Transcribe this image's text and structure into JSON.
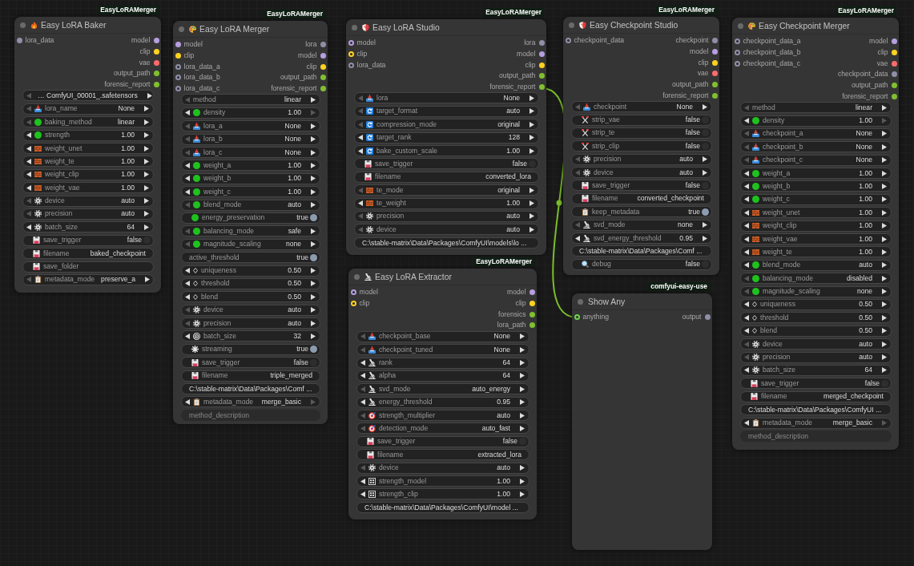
{
  "canvas": {
    "nodes": [
      {
        "badge": "EasyLoRAMerger",
        "title": "Easy LoRA Baker",
        "inputs": [
          {
            "name": "lora_data",
            "color": "#8f8fa8",
            "ring": false
          }
        ],
        "outputs": [
          {
            "name": "model",
            "color": "#b59fe0"
          },
          {
            "name": "clip",
            "color": "#ffd21f"
          },
          {
            "name": "vae",
            "color": "#ff6b6b"
          },
          {
            "name": "output_path",
            "color": "#80c02f"
          },
          {
            "name": "forensic_report",
            "color": "#80c02f"
          }
        ],
        "widgets": [
          {
            "kind": "stepper",
            "value": "… ComfyUI_00001_.safetensors",
            "prev_disabled": true,
            "next_disabled": false
          },
          {
            "kind": "stepper",
            "label": "lora_name",
            "value": "None",
            "prev_disabled": true,
            "next_disabled": false
          },
          {
            "kind": "stepper",
            "label": "baking_method",
            "value": "linear",
            "prev_disabled": true,
            "next_disabled": false
          },
          {
            "kind": "stepper",
            "label": "strength",
            "value": "1.00",
            "prev_disabled": false,
            "next_disabled": false
          },
          {
            "kind": "stepper",
            "label": "weight_unet",
            "value": "1.00",
            "prev_disabled": false,
            "next_disabled": false
          },
          {
            "kind": "stepper",
            "label": "weight_te",
            "value": "1.00",
            "prev_disabled": false,
            "next_disabled": false
          },
          {
            "kind": "stepper",
            "label": "weight_clip",
            "value": "1.00",
            "prev_disabled": false,
            "next_disabled": false
          },
          {
            "kind": "stepper",
            "label": "weight_vae",
            "value": "1.00",
            "prev_disabled": false,
            "next_disabled": false
          },
          {
            "kind": "stepper",
            "label": "device",
            "value": "auto",
            "prev_disabled": true,
            "next_disabled": false
          },
          {
            "kind": "stepper",
            "label": "precision",
            "value": "auto",
            "prev_disabled": true,
            "next_disabled": false
          },
          {
            "kind": "stepper",
            "label": "batch_size",
            "value": "64",
            "prev_disabled": false,
            "next_disabled": false
          },
          {
            "kind": "toggle",
            "label": "save_trigger",
            "value": "false",
            "on": false
          },
          {
            "kind": "text",
            "label": "filename",
            "value": "baked_checkpoint"
          },
          {
            "kind": "text",
            "label": "save_folder"
          },
          {
            "kind": "stepper",
            "label": "metadata_mode",
            "value": "preserve_a",
            "prev_disabled": true,
            "next_disabled": false
          }
        ]
      },
      {
        "badge": "EasyLoRAMerger",
        "title": "Easy LoRA Merger",
        "inputs": [
          {
            "name": "model",
            "color": "#b59fe0",
            "ring": false
          },
          {
            "name": "clip",
            "color": "#ffd21f",
            "ring": false
          },
          {
            "name": "lora_data_a",
            "color": "#8f8fa8",
            "ring": true
          },
          {
            "name": "lora_data_b",
            "color": "#8f8fa8",
            "ring": true
          },
          {
            "name": "lora_data_c",
            "color": "#8f8fa8",
            "ring": true
          }
        ],
        "outputs": [
          {
            "name": "lora",
            "color": "#8f8fa8"
          },
          {
            "name": "model",
            "color": "#b59fe0"
          },
          {
            "name": "clip",
            "color": "#ffd21f"
          },
          {
            "name": "output_path",
            "color": "#80c02f"
          },
          {
            "name": "forensic_report",
            "color": "#80c02f"
          }
        ],
        "widgets": [
          {
            "kind": "stepper",
            "label": "method",
            "value": "linear",
            "prev_disabled": true,
            "next_disabled": false
          },
          {
            "kind": "stepper",
            "label": "density",
            "value": "1.00",
            "prev_disabled": false,
            "next_disabled": true
          },
          {
            "kind": "stepper",
            "label": "lora_a",
            "value": "None",
            "prev_disabled": true,
            "next_disabled": false
          },
          {
            "kind": "stepper",
            "label": "lora_b",
            "value": "None",
            "prev_disabled": true,
            "next_disabled": false
          },
          {
            "kind": "stepper",
            "label": "lora_c",
            "value": "None",
            "prev_disabled": true,
            "next_disabled": false
          },
          {
            "kind": "stepper",
            "label": "weight_a",
            "value": "1.00",
            "prev_disabled": false,
            "next_disabled": false
          },
          {
            "kind": "stepper",
            "label": "weight_b",
            "value": "1.00",
            "prev_disabled": false,
            "next_disabled": false
          },
          {
            "kind": "stepper",
            "label": "weight_c",
            "value": "1.00",
            "prev_disabled": false,
            "next_disabled": false
          },
          {
            "kind": "stepper",
            "label": "blend_mode",
            "value": "auto",
            "prev_disabled": true,
            "next_disabled": false
          },
          {
            "kind": "toggle",
            "label": "energy_preservation",
            "value": "true",
            "on": true
          },
          {
            "kind": "stepper",
            "label": "balancing_mode",
            "value": "safe",
            "prev_disabled": true,
            "next_disabled": false
          },
          {
            "kind": "stepper",
            "label": "magnitude_scaling",
            "value": "none",
            "prev_disabled": true,
            "next_disabled": false
          },
          {
            "kind": "toggle",
            "label": "active_threshold",
            "value": "true",
            "on": true
          },
          {
            "kind": "stepper",
            "label": "uniqueness",
            "value": "0.50",
            "prev_disabled": false,
            "next_disabled": false
          },
          {
            "kind": "stepper",
            "label": "threshold",
            "value": "0.50",
            "prev_disabled": false,
            "next_disabled": false
          },
          {
            "kind": "stepper",
            "label": "blend",
            "value": "0.50",
            "prev_disabled": false,
            "next_disabled": false
          },
          {
            "kind": "stepper",
            "label": "device",
            "value": "auto",
            "prev_disabled": true,
            "next_disabled": false
          },
          {
            "kind": "stepper",
            "label": "precision",
            "value": "auto",
            "prev_disabled": true,
            "next_disabled": false
          },
          {
            "kind": "stepper",
            "label": "batch_size",
            "value": "32",
            "prev_disabled": false,
            "next_disabled": false
          },
          {
            "kind": "toggle",
            "label": "streaming",
            "value": "true",
            "on": true
          },
          {
            "kind": "toggle",
            "label": "save_trigger",
            "value": "false",
            "on": false
          },
          {
            "kind": "text",
            "label": "filename",
            "value": "triple_merged"
          },
          {
            "kind": "text",
            "value": "C:\\stable-matrix\\Data\\Packages\\Comf ..."
          },
          {
            "kind": "stepper",
            "label": "metadata_mode",
            "value": "merge_basic",
            "prev_disabled": false,
            "next_disabled": true
          },
          {
            "kind": "textarea",
            "placeholder": "method_description"
          }
        ]
      },
      {
        "badge": "EasyLoRAMerger",
        "title": "Easy LoRA Studio",
        "inputs": [
          {
            "name": "model",
            "color": "#b59fe0",
            "ring": true
          },
          {
            "name": "clip",
            "color": "#ffd21f",
            "ring": true
          },
          {
            "name": "lora_data",
            "color": "#8f8fa8",
            "ring": true
          }
        ],
        "outputs": [
          {
            "name": "lora",
            "color": "#8f8fa8"
          },
          {
            "name": "model",
            "color": "#b59fe0"
          },
          {
            "name": "clip",
            "color": "#ffd21f"
          },
          {
            "name": "output_path",
            "color": "#80c02f"
          },
          {
            "name": "forensic_report",
            "color": "#80c02f"
          }
        ],
        "widgets": [
          {
            "kind": "stepper",
            "label": "lora",
            "value": "None",
            "prev_disabled": true,
            "next_disabled": false
          },
          {
            "kind": "stepper",
            "label": "target_format",
            "value": "auto",
            "prev_disabled": true,
            "next_disabled": false
          },
          {
            "kind": "stepper",
            "label": "compression_mode",
            "value": "original",
            "prev_disabled": true,
            "next_disabled": false
          },
          {
            "kind": "stepper",
            "label": "target_rank",
            "value": "128",
            "prev_disabled": false,
            "next_disabled": false
          },
          {
            "kind": "stepper",
            "label": "bake_custom_scale",
            "value": "1.00",
            "prev_disabled": false,
            "next_disabled": false
          },
          {
            "kind": "toggle",
            "label": "save_trigger",
            "value": "false",
            "on": false
          },
          {
            "kind": "text",
            "label": "filename",
            "value": "converted_lora"
          },
          {
            "kind": "stepper",
            "label": "te_mode",
            "value": "original",
            "prev_disabled": true,
            "next_disabled": false
          },
          {
            "kind": "stepper",
            "label": "te_weight",
            "value": "1.00",
            "prev_disabled": false,
            "next_disabled": false
          },
          {
            "kind": "stepper",
            "label": "precision",
            "value": "auto",
            "prev_disabled": true,
            "next_disabled": false
          },
          {
            "kind": "stepper",
            "label": "device",
            "value": "auto",
            "prev_disabled": true,
            "next_disabled": false
          },
          {
            "kind": "text",
            "value": "C:\\stable-matrix\\Data\\Packages\\ComfyUI\\models\\lo ..."
          }
        ]
      },
      {
        "badge": "EasyLoRAMerger",
        "title": "Easy LoRA Extractor",
        "inputs": [
          {
            "name": "model",
            "color": "#b59fe0",
            "ring": true
          },
          {
            "name": "clip",
            "color": "#ffd21f",
            "ring": true
          }
        ],
        "outputs": [
          {
            "name": "model",
            "color": "#b59fe0"
          },
          {
            "name": "clip",
            "color": "#ffd21f"
          },
          {
            "name": "forensics",
            "color": "#80c02f"
          },
          {
            "name": "lora_path",
            "color": "#80c02f"
          }
        ],
        "widgets": [
          {
            "kind": "stepper",
            "label": "checkpoint_base",
            "value": "None",
            "prev_disabled": true,
            "next_disabled": false
          },
          {
            "kind": "stepper",
            "label": "checkpoint_tuned",
            "value": "None",
            "prev_disabled": true,
            "next_disabled": false
          },
          {
            "kind": "stepper",
            "label": "rank",
            "value": "64",
            "prev_disabled": false,
            "next_disabled": false
          },
          {
            "kind": "stepper",
            "label": "alpha",
            "value": "64",
            "prev_disabled": false,
            "next_disabled": false
          },
          {
            "kind": "stepper",
            "label": "svd_mode",
            "value": "auto_energy",
            "prev_disabled": true,
            "next_disabled": false
          },
          {
            "kind": "stepper",
            "label": "energy_threshold",
            "value": "0.95",
            "prev_disabled": false,
            "next_disabled": false
          },
          {
            "kind": "stepper",
            "label": "strength_multiplier",
            "value": "auto",
            "prev_disabled": true,
            "next_disabled": false
          },
          {
            "kind": "stepper",
            "label": "detection_mode",
            "value": "auto_fast",
            "prev_disabled": true,
            "next_disabled": false
          },
          {
            "kind": "toggle",
            "label": "save_trigger",
            "value": "false",
            "on": false
          },
          {
            "kind": "text",
            "label": "filename",
            "value": "extracted_lora"
          },
          {
            "kind": "stepper",
            "label": "device",
            "value": "auto",
            "prev_disabled": true,
            "next_disabled": false
          },
          {
            "kind": "stepper",
            "label": "strength_model",
            "value": "1.00",
            "prev_disabled": false,
            "next_disabled": false
          },
          {
            "kind": "stepper",
            "label": "strength_clip",
            "value": "1.00",
            "prev_disabled": false,
            "next_disabled": false
          },
          {
            "kind": "text",
            "value": "C:\\stable-matrix\\Data\\Packages\\ComfyUI\\model ..."
          }
        ]
      },
      {
        "badge": "EasyLoRAMerger",
        "title": "Easy Checkpoint Studio",
        "inputs": [
          {
            "name": "checkpoint_data",
            "color": "#8f8fa8",
            "ring": true
          }
        ],
        "outputs": [
          {
            "name": "checkpoint",
            "color": "#8f8fa8"
          },
          {
            "name": "model",
            "color": "#b59fe0"
          },
          {
            "name": "clip",
            "color": "#ffd21f"
          },
          {
            "name": "vae",
            "color": "#ff6b6b"
          },
          {
            "name": "output_path",
            "color": "#80c02f"
          },
          {
            "name": "forensic_report",
            "color": "#80c02f"
          }
        ],
        "widgets": [
          {
            "kind": "stepper",
            "label": "checkpoint",
            "value": "None",
            "prev_disabled": true,
            "next_disabled": false
          },
          {
            "kind": "toggle",
            "label": "strip_vae",
            "value": "false",
            "on": false
          },
          {
            "kind": "toggle",
            "label": "strip_te",
            "value": "false",
            "on": false
          },
          {
            "kind": "toggle",
            "label": "strip_clip",
            "value": "false",
            "on": false
          },
          {
            "kind": "stepper",
            "label": "precision",
            "value": "auto",
            "prev_disabled": true,
            "next_disabled": false
          },
          {
            "kind": "stepper",
            "label": "device",
            "value": "auto",
            "prev_disabled": true,
            "next_disabled": false
          },
          {
            "kind": "toggle",
            "label": "save_trigger",
            "value": "false",
            "on": false
          },
          {
            "kind": "text",
            "label": "filename",
            "value": "converted_checkpoint"
          },
          {
            "kind": "toggle",
            "label": "keep_metadata",
            "value": "true",
            "on": true
          },
          {
            "kind": "stepper",
            "label": "svd_mode",
            "value": "none",
            "prev_disabled": true,
            "next_disabled": false
          },
          {
            "kind": "stepper",
            "label": "svd_energy_threshold",
            "value": "0.95",
            "prev_disabled": false,
            "next_disabled": false
          },
          {
            "kind": "text",
            "value": "C:\\stable-matrix\\Data\\Packages\\Comf ..."
          },
          {
            "kind": "toggle",
            "label": "debug",
            "value": "false",
            "on": false
          }
        ]
      },
      {
        "badge": "comfyui-easy-use",
        "title": "Show Any",
        "inputs": [
          {
            "name": "anything",
            "color": "#6fd14f",
            "ring": true
          }
        ],
        "outputs": [
          {
            "name": "output",
            "color": "#8f8fa8"
          }
        ]
      },
      {
        "badge": "EasyLoRAMerger",
        "title": "Easy Checkpoint Merger",
        "inputs": [
          {
            "name": "checkpoint_data_a",
            "color": "#8f8fa8",
            "ring": true
          },
          {
            "name": "checkpoint_data_b",
            "color": "#8f8fa8",
            "ring": true
          },
          {
            "name": "checkpoint_data_c",
            "color": "#8f8fa8",
            "ring": true
          }
        ],
        "outputs": [
          {
            "name": "model",
            "color": "#b59fe0"
          },
          {
            "name": "clip",
            "color": "#ffd21f"
          },
          {
            "name": "vae",
            "color": "#ff6b6b"
          },
          {
            "name": "checkpoint_data",
            "color": "#8f8fa8"
          },
          {
            "name": "output_path",
            "color": "#80c02f"
          },
          {
            "name": "forensic_report",
            "color": "#80c02f"
          }
        ],
        "widgets": [
          {
            "kind": "stepper",
            "label": "method",
            "value": "linear",
            "prev_disabled": true,
            "next_disabled": false
          },
          {
            "kind": "stepper",
            "label": "density",
            "value": "1.00",
            "prev_disabled": false,
            "next_disabled": true
          },
          {
            "kind": "stepper",
            "label": "checkpoint_a",
            "value": "None",
            "prev_disabled": true,
            "next_disabled": false
          },
          {
            "kind": "stepper",
            "label": "checkpoint_b",
            "value": "None",
            "prev_disabled": true,
            "next_disabled": false
          },
          {
            "kind": "stepper",
            "label": "checkpoint_c",
            "value": "None",
            "prev_disabled": true,
            "next_disabled": false
          },
          {
            "kind": "stepper",
            "label": "weight_a",
            "value": "1.00",
            "prev_disabled": false,
            "next_disabled": false
          },
          {
            "kind": "stepper",
            "label": "weight_b",
            "value": "1.00",
            "prev_disabled": false,
            "next_disabled": false
          },
          {
            "kind": "stepper",
            "label": "weight_c",
            "value": "1.00",
            "prev_disabled": false,
            "next_disabled": false
          },
          {
            "kind": "stepper",
            "label": "weight_unet",
            "value": "1.00",
            "prev_disabled": false,
            "next_disabled": false
          },
          {
            "kind": "stepper",
            "label": "weight_clip",
            "value": "1.00",
            "prev_disabled": false,
            "next_disabled": false
          },
          {
            "kind": "stepper",
            "label": "weight_vae",
            "value": "1.00",
            "prev_disabled": false,
            "next_disabled": false
          },
          {
            "kind": "stepper",
            "label": "weight_te",
            "value": "1.00",
            "prev_disabled": false,
            "next_disabled": false
          },
          {
            "kind": "stepper",
            "label": "blend_mode",
            "value": "auto",
            "prev_disabled": false,
            "next_disabled": false
          },
          {
            "kind": "stepper",
            "label": "balancing_mode",
            "value": "disabled",
            "prev_disabled": true,
            "next_disabled": false
          },
          {
            "kind": "stepper",
            "label": "magnitude_scaling",
            "value": "none",
            "prev_disabled": true,
            "next_disabled": false
          },
          {
            "kind": "stepper",
            "label": "uniqueness",
            "value": "0.50",
            "prev_disabled": false,
            "next_disabled": false
          },
          {
            "kind": "stepper",
            "label": "threshold",
            "value": "0.50",
            "prev_disabled": false,
            "next_disabled": false
          },
          {
            "kind": "stepper",
            "label": "blend",
            "value": "0.50",
            "prev_disabled": false,
            "next_disabled": false
          },
          {
            "kind": "stepper",
            "label": "device",
            "value": "auto",
            "prev_disabled": true,
            "next_disabled": false
          },
          {
            "kind": "stepper",
            "label": "precision",
            "value": "auto",
            "prev_disabled": true,
            "next_disabled": false
          },
          {
            "kind": "stepper",
            "label": "batch_size",
            "value": "64",
            "prev_disabled": false,
            "next_disabled": false
          },
          {
            "kind": "toggle",
            "label": "save_trigger",
            "value": "false",
            "on": false
          },
          {
            "kind": "text",
            "label": "filename",
            "value": "merged_checkpoint"
          },
          {
            "kind": "text",
            "value": "C:\\stable-matrix\\Data\\Packages\\ComfyUI ..."
          },
          {
            "kind": "stepper",
            "label": "metadata_mode",
            "value": "merge_basic",
            "prev_disabled": false,
            "next_disabled": true
          },
          {
            "kind": "textarea",
            "placeholder": "method_description"
          }
        ]
      }
    ]
  }
}
